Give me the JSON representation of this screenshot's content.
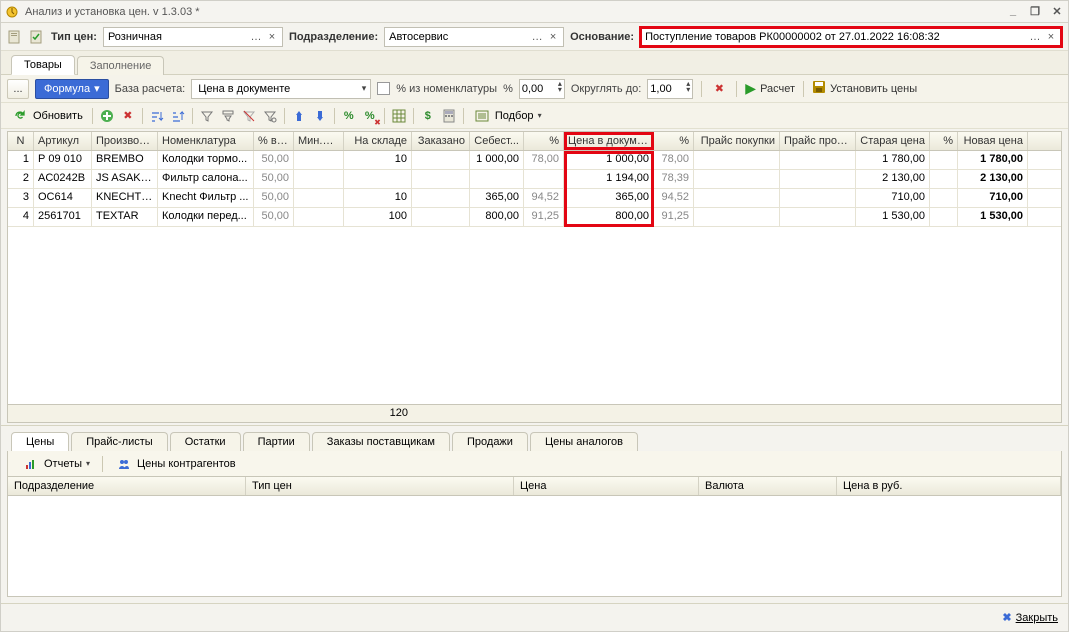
{
  "title": "Анализ и установка цен. v 1.3.03 *",
  "header": {
    "price_type_label": "Тип цен:",
    "price_type": "Розничная",
    "division_label": "Подразделение:",
    "division": "Автосервис",
    "basis_label": "Основание:",
    "basis": "Поступление товаров РК00000002 от 27.01.2022 16:08:32"
  },
  "tabs": {
    "goods": "Товары",
    "fill": "Заполнение"
  },
  "formula": {
    "dots": "...",
    "formula_btn": "Формула",
    "base_label": "База расчета:",
    "base_value": "Цена в документе",
    "from_nom_label": "% из номенклатуры",
    "pct_sign": "%",
    "pct_value": "0,00",
    "round_label": "Округлять до:",
    "round_value": "1,00",
    "calc": "Расчет",
    "set_prices": "Установить цены"
  },
  "toolbar2": {
    "refresh": "Обновить",
    "pick": "Подбор"
  },
  "columns": {
    "n": "N",
    "art": "Артикул",
    "prod": "Производ...",
    "nom": "Номенклатура",
    "pct": "% в н...",
    "min": "Мин.ост",
    "stk": "На складе",
    "ord": "Заказано",
    "cost": "Себест...",
    "p1": "%",
    "doc": "Цена в докуме...",
    "p2": "%",
    "buy": "Прайс покупки",
    "sell": "Прайс прода...",
    "old": "Старая цена",
    "p3": "%",
    "new": "Новая цена"
  },
  "rows": [
    {
      "n": "1",
      "art": "Р 09 010",
      "prod": "BREMBO",
      "nom": "Колодки тормо...",
      "pct": "50,00",
      "min": "",
      "stk": "10",
      "ord": "",
      "cost": "1 000,00",
      "p1": "78,00",
      "doc": "1 000,00",
      "p2": "78,00",
      "buy": "",
      "sell": "",
      "old": "1 780,00",
      "p3": "",
      "new": "1 780,00"
    },
    {
      "n": "2",
      "art": "AC0242B",
      "prod": "JS ASAKA...",
      "nom": "Фильтр салона...",
      "pct": "50,00",
      "min": "",
      "stk": "",
      "ord": "",
      "cost": "",
      "p1": "",
      "doc": "1 194,00",
      "p2": "78,39",
      "buy": "",
      "sell": "",
      "old": "2 130,00",
      "p3": "",
      "new": "2 130,00"
    },
    {
      "n": "3",
      "art": "OC614",
      "prod": "KNECHT/...",
      "nom": "Knecht Фильтр ...",
      "pct": "50,00",
      "min": "",
      "stk": "10",
      "ord": "",
      "cost": "365,00",
      "p1": "94,52",
      "doc": "365,00",
      "p2": "94,52",
      "buy": "",
      "sell": "",
      "old": "710,00",
      "p3": "",
      "new": "710,00"
    },
    {
      "n": "4",
      "art": "2561701",
      "prod": "TEXTAR",
      "nom": "Колодки перед...",
      "pct": "50,00",
      "min": "",
      "stk": "100",
      "ord": "",
      "cost": "800,00",
      "p1": "91,25",
      "doc": "800,00",
      "p2": "91,25",
      "buy": "",
      "sell": "",
      "old": "1 530,00",
      "p3": "",
      "new": "1 530,00"
    }
  ],
  "footer_sum": {
    "stk": "120"
  },
  "bottom_tabs": {
    "prices": "Цены",
    "pricelists": "Прайс-листы",
    "remains": "Остатки",
    "parties": "Партии",
    "orders": "Заказы поставщикам",
    "sales": "Продажи",
    "analog": "Цены аналогов"
  },
  "reports_bar": {
    "reports": "Отчеты",
    "counter_prices": "Цены контрагентов"
  },
  "bottom_cols": {
    "pod": "Подразделение",
    "tip": "Тип цен",
    "price": "Цена",
    "val": "Валюта",
    "rub": "Цена в руб."
  },
  "close_btn": "Закрыть"
}
